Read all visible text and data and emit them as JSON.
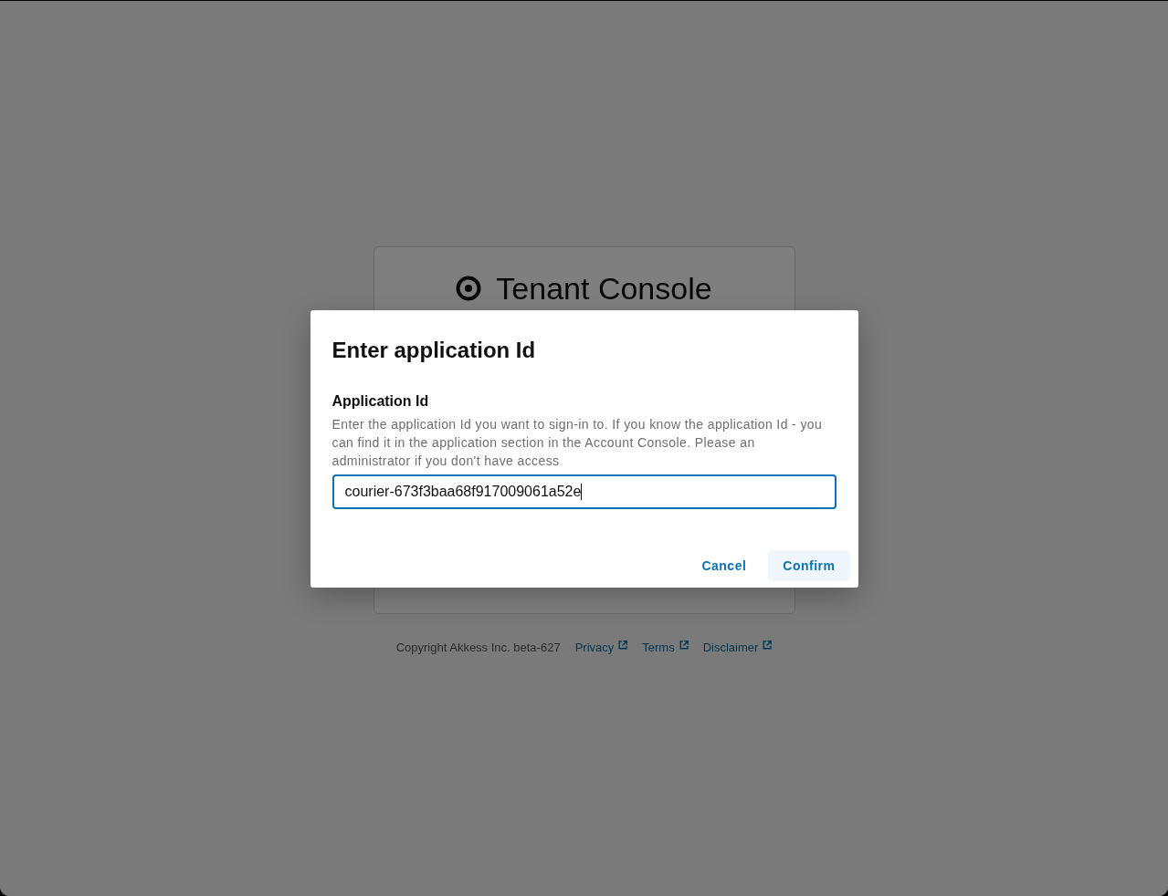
{
  "page": {
    "app_title": "Tenant Console"
  },
  "footer": {
    "copyright": "Copyright Akkess Inc. beta-627",
    "links": [
      {
        "label": "Privacy"
      },
      {
        "label": "Terms"
      },
      {
        "label": "Disclaimer"
      }
    ]
  },
  "dialog": {
    "title": "Enter application Id",
    "field": {
      "label": "Application Id",
      "help": "Enter the application Id you want to sign-in to. If you know the application Id - you can find it in the application section in the Account Console. Please an administrator if you don't have access",
      "value": "courier-673f3baa68f917009061a52e",
      "focused": true
    },
    "buttons": [
      {
        "label": "Cancel",
        "kind": "text"
      },
      {
        "label": "Confirm",
        "kind": "tonal"
      }
    ]
  }
}
